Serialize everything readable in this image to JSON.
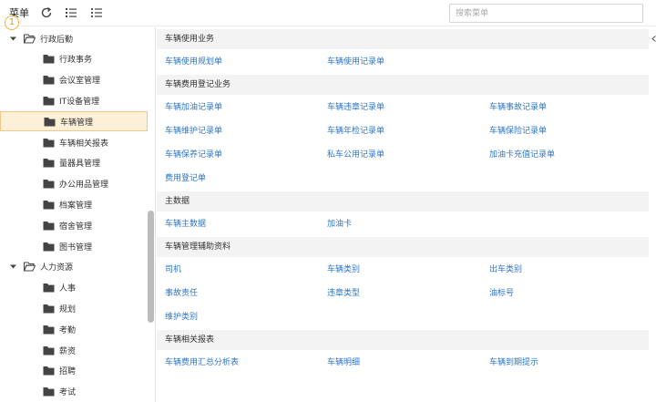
{
  "header": {
    "menu_label": "菜单",
    "search_placeholder": "搜索菜单"
  },
  "badge_number": "1",
  "tree": {
    "items": [
      {
        "label": "行政后勤",
        "level": 0,
        "expanded": true
      },
      {
        "label": "行政事务",
        "level": 1
      },
      {
        "label": "会议室管理",
        "level": 1
      },
      {
        "label": "IT设备管理",
        "level": 1
      },
      {
        "label": "车辆管理",
        "level": 1,
        "selected": true
      },
      {
        "label": "车辆相关报表",
        "level": 1
      },
      {
        "label": "量器具管理",
        "level": 1
      },
      {
        "label": "办公用品管理",
        "level": 1
      },
      {
        "label": "档案管理",
        "level": 1
      },
      {
        "label": "宿舍管理",
        "level": 1
      },
      {
        "label": "图书管理",
        "level": 1
      },
      {
        "label": "人力资源",
        "level": 0,
        "expanded": true
      },
      {
        "label": "人事",
        "level": 1
      },
      {
        "label": "规划",
        "level": 1
      },
      {
        "label": "考勤",
        "level": 1
      },
      {
        "label": "薪资",
        "level": 1
      },
      {
        "label": "招聘",
        "level": 1
      },
      {
        "label": "考试",
        "level": 1
      }
    ]
  },
  "sections": [
    {
      "title": "车辆使用业务",
      "links": [
        "车辆使用规划单",
        "车辆使用记录单"
      ]
    },
    {
      "title": "车辆费用登记业务",
      "links": [
        "车辆加油记录单",
        "车辆违章记录单",
        "车辆事故记录单",
        "车辆维护记录单",
        "车辆年检记录单",
        "车辆保险记录单",
        "车辆保养记录单",
        "私车公用记录单",
        "加油卡充值记录单",
        "费用登记单"
      ]
    },
    {
      "title": "主数据",
      "links": [
        "车辆主数据",
        "加油卡"
      ]
    },
    {
      "title": "车辆管理辅助资料",
      "links": [
        "司机",
        "车辆类别",
        "出车类别",
        "事故责任",
        "违章类型",
        "油标号",
        "维护类别"
      ]
    },
    {
      "title": "车辆相关报表",
      "links": [
        "车辆费用汇总分析表",
        "车辆明细",
        "车辆到期提示"
      ]
    }
  ],
  "colors": {
    "link": "#2d76c9",
    "section_bg": "#f3f3f3",
    "selected_bg": "#fdf0d9",
    "badge": "#f2b13a"
  }
}
